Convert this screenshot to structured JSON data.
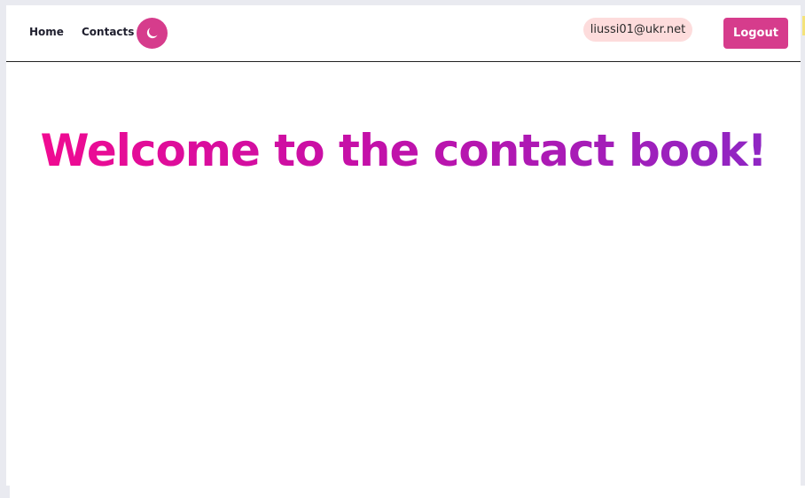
{
  "nav": {
    "home_label": "Home",
    "contacts_label": "Contacts",
    "theme_icon": "moon-icon"
  },
  "user": {
    "email": "liussi01@ukr.net",
    "logout_label": "Logout"
  },
  "main": {
    "title": "Welcome to the contact book!"
  },
  "colors": {
    "accent": "#d63c8c",
    "email_badge_bg": "#fddcdc",
    "title_gradient_start": "#f50a8f",
    "title_gradient_end": "#8a28c6"
  }
}
